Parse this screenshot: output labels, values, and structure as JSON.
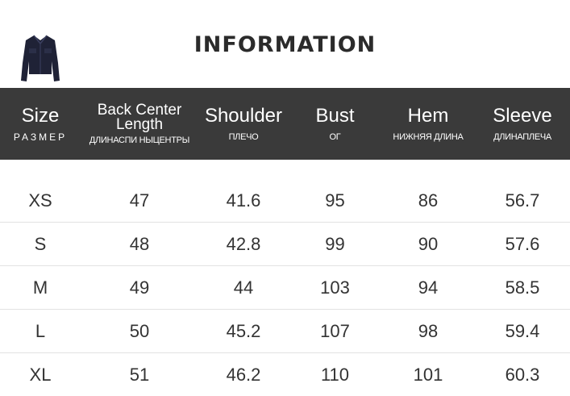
{
  "title": "INFORMATION",
  "product_icon": "denim-jacket-icon",
  "colors": {
    "header_bg": "#3a3a3a",
    "jacket": "#1f2236"
  },
  "headers": [
    {
      "en": "Size",
      "ru": "РАЗМЕР"
    },
    {
      "en": "Back Center Length",
      "ru": "ДЛИНАСПИ НЫЦЕНТРЫ"
    },
    {
      "en": "Shoulder",
      "ru": "ПЛЕЧО"
    },
    {
      "en": "Bust",
      "ru": "ОГ"
    },
    {
      "en": "Hem",
      "ru": "НИЖНЯЯ ДЛИНА"
    },
    {
      "en": "Sleeve",
      "ru": "ДЛИНАПЛЕЧА"
    }
  ],
  "rows": [
    [
      "XS",
      "47",
      "41.6",
      "95",
      "86",
      "56.7"
    ],
    [
      "S",
      "48",
      "42.8",
      "99",
      "90",
      "57.6"
    ],
    [
      "M",
      "49",
      "44",
      "103",
      "94",
      "58.5"
    ],
    [
      "L",
      "50",
      "45.2",
      "107",
      "98",
      "59.4"
    ],
    [
      "XL",
      "51",
      "46.2",
      "110",
      "101",
      "60.3"
    ]
  ]
}
